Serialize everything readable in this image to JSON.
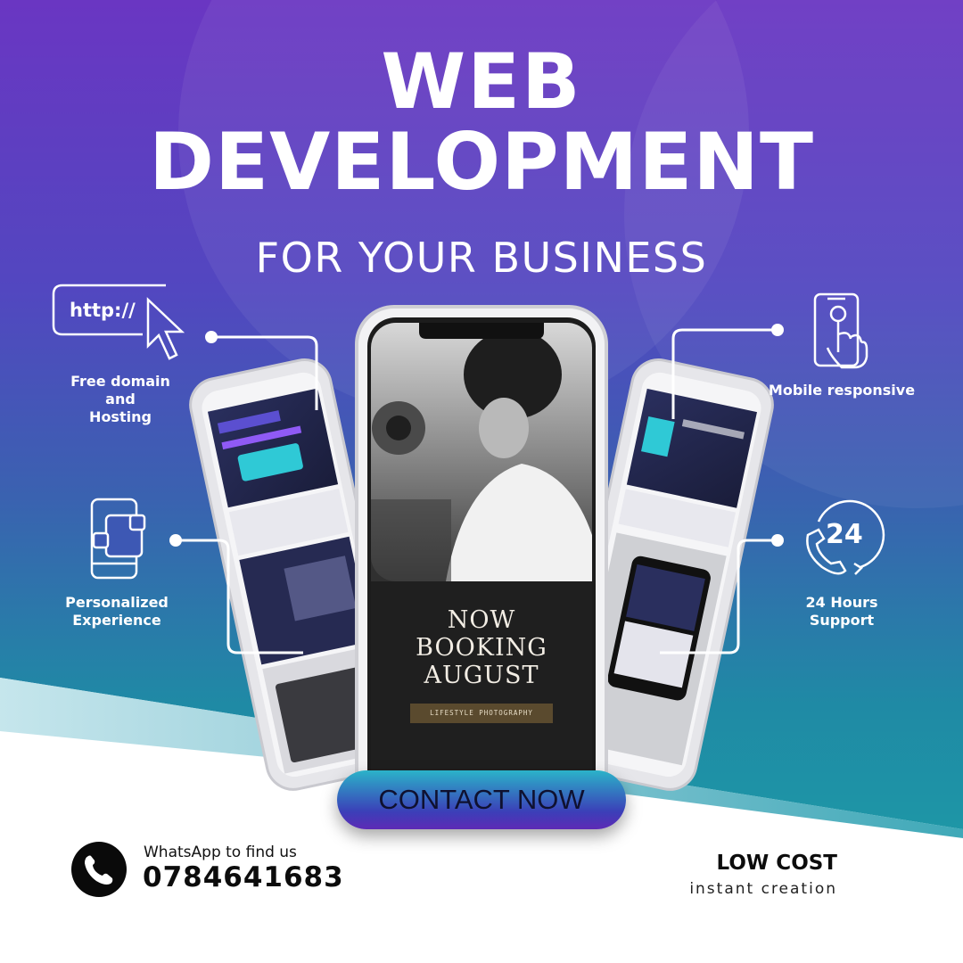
{
  "headline": {
    "line1": "WEB",
    "line2": "DEVELOPMENT",
    "tagline": "FOR YOUR BUSINESS"
  },
  "features": {
    "domain": {
      "icon": "url-cursor-icon",
      "icon_text": "http://",
      "line1": "Free domain",
      "line2": "and",
      "line3": "Hosting"
    },
    "personalized": {
      "icon": "phone-apps-icon",
      "line1": "Personalized",
      "line2": "Experience"
    },
    "mobile": {
      "icon": "touch-phone-icon",
      "line1": "Mobile responsive"
    },
    "support": {
      "icon": "phone-support-icon",
      "icon_text": "24",
      "line1": "24 Hours",
      "line2": "Support"
    }
  },
  "phone_screen": {
    "line1": "NOW",
    "line2": "BOOKING",
    "line3": "AUGUST",
    "tag": "LIFESTYLE PHOTOGRAPHY"
  },
  "cta": {
    "label": "CONTACT NOW"
  },
  "whatsapp": {
    "icon": "whatsapp-phone-icon",
    "label": "WhatsApp to find us",
    "number": "0784641683"
  },
  "offer": {
    "title": "LOW COST",
    "subtitle": "instant creation"
  },
  "colors": {
    "purple": "#5b34c4",
    "blue": "#3b55b8",
    "teal": "#1f8ea6",
    "accent_brown": "#5a4a2e"
  }
}
